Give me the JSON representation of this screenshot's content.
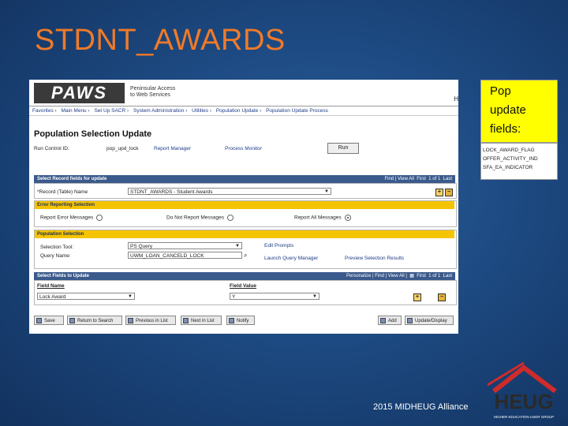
{
  "slide": {
    "title": "STDNT_AWARDS",
    "footer": "2015 MIDHEUG Alliance"
  },
  "callout": {
    "lines": [
      "Pop",
      "update",
      "fields:"
    ],
    "fields": [
      "LOCK_AWARD_FLAG",
      "OFFER_ACTIVITY_IND",
      "SFA_EA_INDICATOR"
    ]
  },
  "logo": {
    "text": "HEUG",
    "tagline": "HIGHER EDUCATION USER GROUP"
  },
  "app": {
    "brand": "PAWS",
    "brand_sub": [
      "Peninsular Access",
      "to Web Services"
    ],
    "banner_right": "H",
    "breadcrumb": [
      "Favorites",
      "Main Menu",
      "Set Up SACR",
      "System Administration",
      "Utilities",
      "Population Update",
      "Population Update Process"
    ],
    "page_title": "Population Selection Update",
    "run_control_label": "Run Control ID:",
    "run_control_value": "pop_upd_lock",
    "report_manager": "Report Manager",
    "process_monitor": "Process Monitor",
    "run_button": "Run",
    "record_section": {
      "header": "Select Record fields for update",
      "nav": "Find | View All",
      "pager": "First",
      "count": "1 of 1",
      "last": "Last",
      "record_label": "*Record (Table) Name",
      "record_value": "STDNT_AWARDS - Student Awards"
    },
    "error_section": {
      "header": "Error Reporting Selection",
      "options": [
        "Report Error Messages",
        "Do Not Report Messages",
        "Report All Messages"
      ],
      "selected": "Report All Messages"
    },
    "population_section": {
      "header": "Population Selection",
      "tool_label": "Selection Tool:",
      "tool_value": "PS Query",
      "query_label": "Query Name:",
      "query_value": "UWM_LOAN_CANCELD_LOCK",
      "edit_prompts": "Edit Prompts",
      "launch_query_manager": "Launch Query Manager",
      "preview_results": "Preview Selection Results"
    },
    "fields_section": {
      "header": "Select Fields to Update",
      "nav": "Personalize | Find | View All |",
      "pager": "First",
      "count": "1 of 1",
      "last": "Last",
      "col_field_name": "Field Name",
      "col_field_value": "Field Value",
      "field_name": "Lock Award",
      "field_value": "Y"
    },
    "toolbar": {
      "save": "Save",
      "return_to_search": "Return to Search",
      "previous_in_list": "Previous in List",
      "next_in_list": "Next in List",
      "notify": "Notify",
      "add": "Add",
      "update_display": "Update/Display"
    }
  }
}
